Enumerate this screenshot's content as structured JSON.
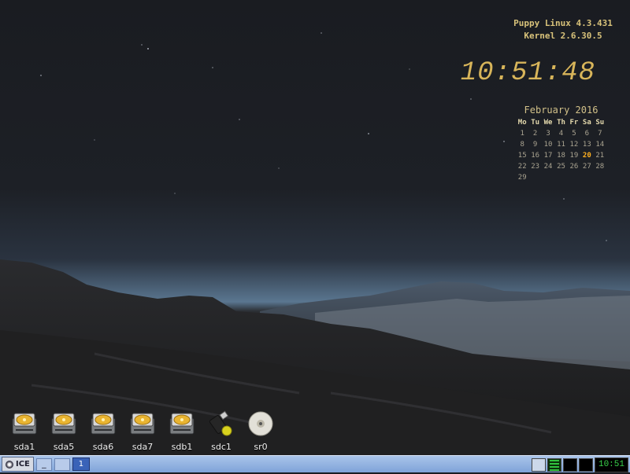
{
  "conky": {
    "os_line": "Puppy Linux 4.3.431",
    "kernel_line": "Kernel 2.6.30.5",
    "clock": "10:51:48"
  },
  "calendar": {
    "title": "February  2016",
    "weekdays": [
      "Mo",
      "Tu",
      "We",
      "Th",
      "Fr",
      "Sa",
      "Su"
    ],
    "days": [
      "1",
      "2",
      "3",
      "4",
      "5",
      "6",
      "7",
      "8",
      "9",
      "10",
      "11",
      "12",
      "13",
      "14",
      "15",
      "16",
      "17",
      "18",
      "19",
      "20",
      "21",
      "22",
      "23",
      "24",
      "25",
      "26",
      "27",
      "28",
      "29"
    ],
    "today": "20"
  },
  "drives": [
    {
      "label": "sda1",
      "icon": "hard-drive-icon"
    },
    {
      "label": "sda5",
      "icon": "hard-drive-icon"
    },
    {
      "label": "sda6",
      "icon": "hard-drive-icon"
    },
    {
      "label": "sda7",
      "icon": "hard-drive-icon"
    },
    {
      "label": "sdb1",
      "icon": "hard-drive-icon"
    },
    {
      "label": "sdc1",
      "icon": "usb-drive-icon"
    },
    {
      "label": "sr0",
      "icon": "optical-disc-icon"
    }
  ],
  "taskbar": {
    "start_label": "ICE",
    "minimize_label": "_",
    "workspace": "1",
    "tray_clock": "10:51"
  },
  "colors": {
    "taskbar": "#7fa3d8",
    "conky_text": "#d8c27a",
    "today": "#ffb020",
    "tray_clock": "#39d24b"
  }
}
